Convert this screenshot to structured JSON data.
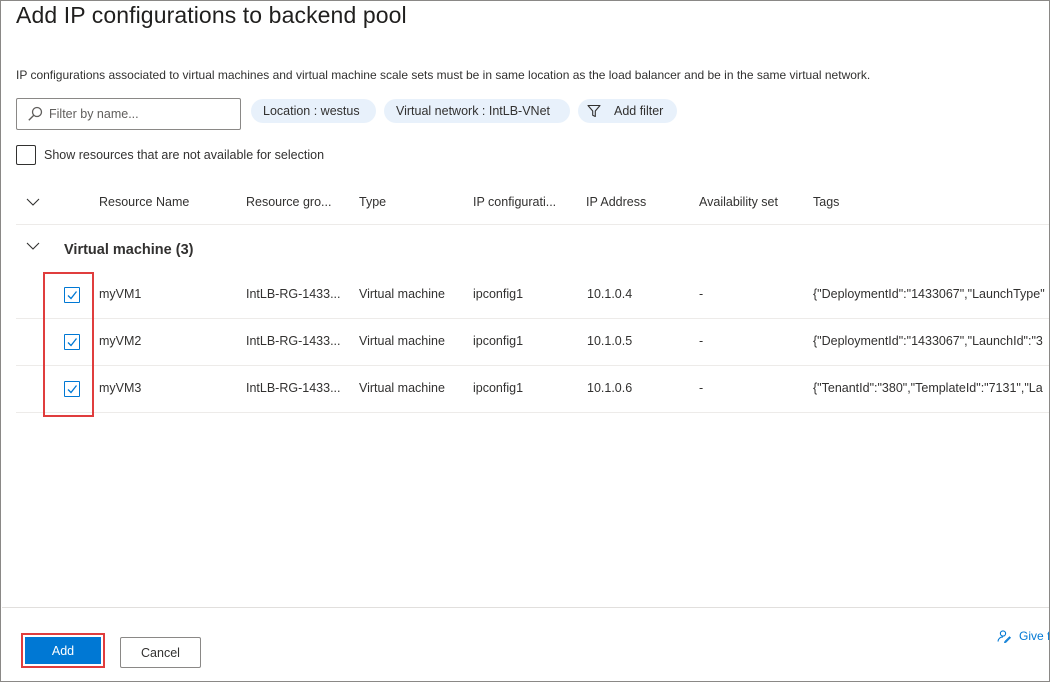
{
  "title": "Add IP configurations to backend pool",
  "description": "IP configurations associated to virtual machines and virtual machine scale sets must be in same location as the load balancer and be in the same virtual network.",
  "filter": {
    "placeholder": "Filter by name..."
  },
  "pills": {
    "location": "Location : westus",
    "vnet": "Virtual network : IntLB-VNet",
    "add_filter": "Add filter"
  },
  "show_unavailable_label": "Show resources that are not available for selection",
  "columns": [
    "Resource Name",
    "Resource gro...",
    "Type",
    "IP configurati...",
    "IP Address",
    "Availability set",
    "Tags"
  ],
  "group": {
    "label": "Virtual machine (3)"
  },
  "rows": [
    {
      "name": "myVM1",
      "resource_group": "IntLB-RG-1433...",
      "type": "Virtual machine",
      "ip_config": "ipconfig1",
      "ip_address": "10.1.0.4",
      "availability_set": "-",
      "tags": "{\"DeploymentId\":\"1433067\",\"LaunchType\"",
      "checked": true
    },
    {
      "name": "myVM2",
      "resource_group": "IntLB-RG-1433...",
      "type": "Virtual machine",
      "ip_config": "ipconfig1",
      "ip_address": "10.1.0.5",
      "availability_set": "-",
      "tags": "{\"DeploymentId\":\"1433067\",\"LaunchId\":\"3",
      "checked": true
    },
    {
      "name": "myVM3",
      "resource_group": "IntLB-RG-1433...",
      "type": "Virtual machine",
      "ip_config": "ipconfig1",
      "ip_address": "10.1.0.6",
      "availability_set": "-",
      "tags": "{\"TenantId\":\"380\",\"TemplateId\":\"7131\",\"La",
      "checked": true
    }
  ],
  "footer": {
    "add_label": "Add",
    "cancel_label": "Cancel",
    "feedback_label": "Give f"
  },
  "colors": {
    "accent": "#0078d4",
    "highlight": "#e03d3d",
    "pill_bg": "#e8f1fb"
  },
  "icons": {
    "filter_search": "search-icon",
    "add_filter": "funnel-icon",
    "expand": "chevron-down-icon",
    "checkbox": "checkmark-icon",
    "feedback": "feedback-person-icon"
  }
}
